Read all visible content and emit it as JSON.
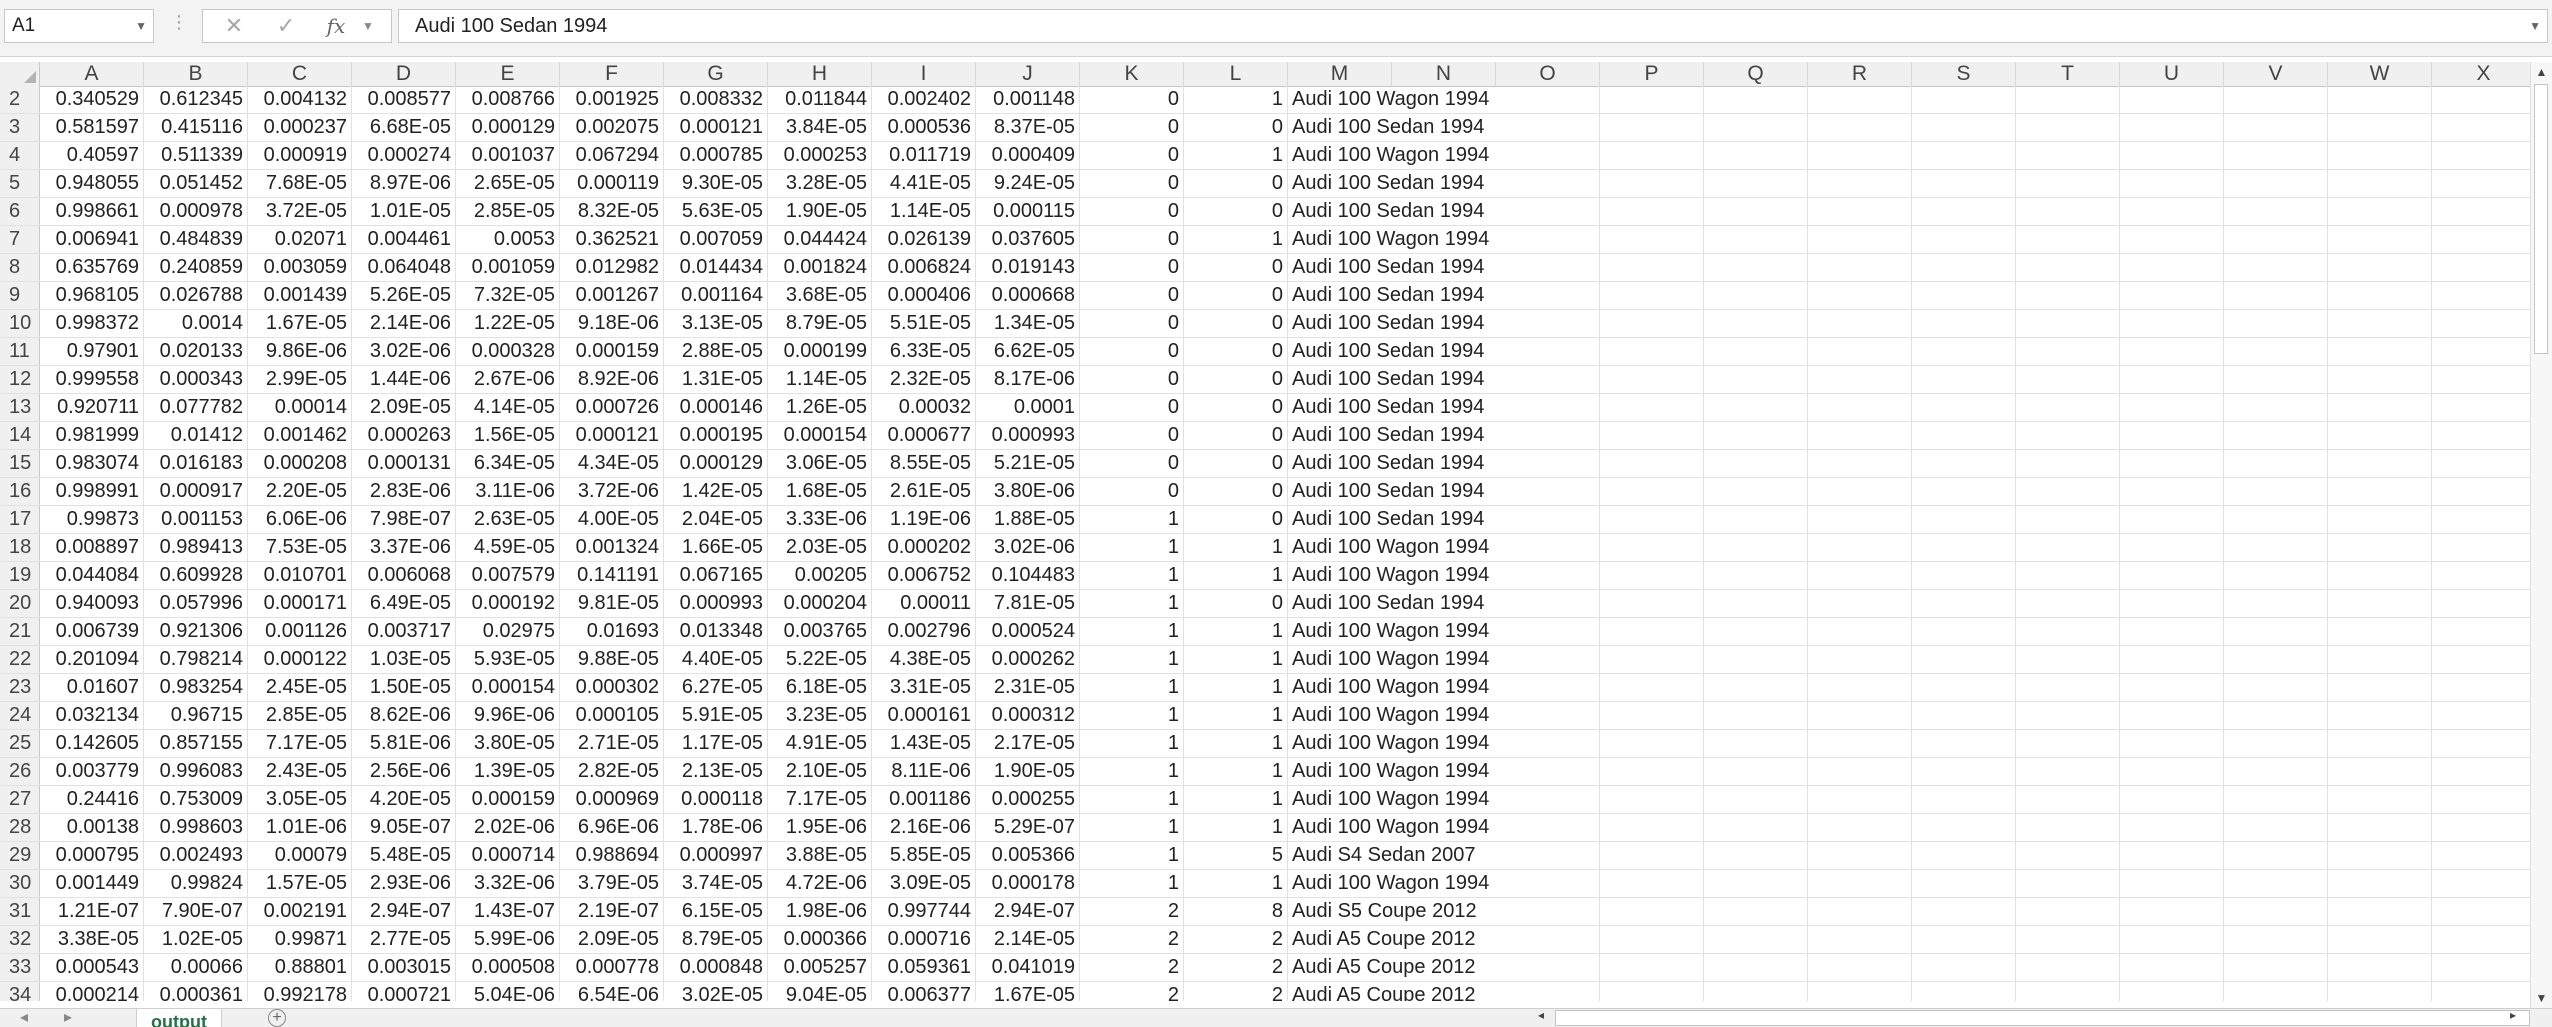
{
  "formula_bar": {
    "name_box": "A1",
    "formula": "Audi 100 Sedan 1994",
    "cancel_icon": "x-icon",
    "enter_icon": "check-icon",
    "function_label": "fx"
  },
  "columns": [
    "A",
    "B",
    "C",
    "D",
    "E",
    "F",
    "G",
    "H",
    "I",
    "J",
    "K",
    "L",
    "M",
    "N",
    "O",
    "P",
    "Q",
    "R",
    "S",
    "T",
    "U",
    "V",
    "W",
    "X"
  ],
  "rows": [
    {
      "n": "2",
      "v": [
        "0.340529",
        "0.612345",
        "0.004132",
        "0.008577",
        "0.008766",
        "0.001925",
        "0.008332",
        "0.011844",
        "0.002402",
        "0.001148",
        "0",
        "1",
        "Audi 100 Wagon 1994"
      ]
    },
    {
      "n": "3",
      "v": [
        "0.581597",
        "0.415116",
        "0.000237",
        "6.68E-05",
        "0.000129",
        "0.002075",
        "0.000121",
        "3.84E-05",
        "0.000536",
        "8.37E-05",
        "0",
        "0",
        "Audi 100 Sedan 1994"
      ]
    },
    {
      "n": "4",
      "v": [
        "0.40597",
        "0.511339",
        "0.000919",
        "0.000274",
        "0.001037",
        "0.067294",
        "0.000785",
        "0.000253",
        "0.011719",
        "0.000409",
        "0",
        "1",
        "Audi 100 Wagon 1994"
      ]
    },
    {
      "n": "5",
      "v": [
        "0.948055",
        "0.051452",
        "7.68E-05",
        "8.97E-06",
        "2.65E-05",
        "0.000119",
        "9.30E-05",
        "3.28E-05",
        "4.41E-05",
        "9.24E-05",
        "0",
        "0",
        "Audi 100 Sedan 1994"
      ]
    },
    {
      "n": "6",
      "v": [
        "0.998661",
        "0.000978",
        "3.72E-05",
        "1.01E-05",
        "2.85E-05",
        "8.32E-05",
        "5.63E-05",
        "1.90E-05",
        "1.14E-05",
        "0.000115",
        "0",
        "0",
        "Audi 100 Sedan 1994"
      ]
    },
    {
      "n": "7",
      "v": [
        "0.006941",
        "0.484839",
        "0.02071",
        "0.004461",
        "0.0053",
        "0.362521",
        "0.007059",
        "0.044424",
        "0.026139",
        "0.037605",
        "0",
        "1",
        "Audi 100 Wagon 1994"
      ]
    },
    {
      "n": "8",
      "v": [
        "0.635769",
        "0.240859",
        "0.003059",
        "0.064048",
        "0.001059",
        "0.012982",
        "0.014434",
        "0.001824",
        "0.006824",
        "0.019143",
        "0",
        "0",
        "Audi 100 Sedan 1994"
      ]
    },
    {
      "n": "9",
      "v": [
        "0.968105",
        "0.026788",
        "0.001439",
        "5.26E-05",
        "7.32E-05",
        "0.001267",
        "0.001164",
        "3.68E-05",
        "0.000406",
        "0.000668",
        "0",
        "0",
        "Audi 100 Sedan 1994"
      ]
    },
    {
      "n": "10",
      "v": [
        "0.998372",
        "0.0014",
        "1.67E-05",
        "2.14E-06",
        "1.22E-05",
        "9.18E-06",
        "3.13E-05",
        "8.79E-05",
        "5.51E-05",
        "1.34E-05",
        "0",
        "0",
        "Audi 100 Sedan 1994"
      ]
    },
    {
      "n": "11",
      "v": [
        "0.97901",
        "0.020133",
        "9.86E-06",
        "3.02E-06",
        "0.000328",
        "0.000159",
        "2.88E-05",
        "0.000199",
        "6.33E-05",
        "6.62E-05",
        "0",
        "0",
        "Audi 100 Sedan 1994"
      ]
    },
    {
      "n": "12",
      "v": [
        "0.999558",
        "0.000343",
        "2.99E-05",
        "1.44E-06",
        "2.67E-06",
        "8.92E-06",
        "1.31E-05",
        "1.14E-05",
        "2.32E-05",
        "8.17E-06",
        "0",
        "0",
        "Audi 100 Sedan 1994"
      ]
    },
    {
      "n": "13",
      "v": [
        "0.920711",
        "0.077782",
        "0.00014",
        "2.09E-05",
        "4.14E-05",
        "0.000726",
        "0.000146",
        "1.26E-05",
        "0.00032",
        "0.0001",
        "0",
        "0",
        "Audi 100 Sedan 1994"
      ]
    },
    {
      "n": "14",
      "v": [
        "0.981999",
        "0.01412",
        "0.001462",
        "0.000263",
        "1.56E-05",
        "0.000121",
        "0.000195",
        "0.000154",
        "0.000677",
        "0.000993",
        "0",
        "0",
        "Audi 100 Sedan 1994"
      ]
    },
    {
      "n": "15",
      "v": [
        "0.983074",
        "0.016183",
        "0.000208",
        "0.000131",
        "6.34E-05",
        "4.34E-05",
        "0.000129",
        "3.06E-05",
        "8.55E-05",
        "5.21E-05",
        "0",
        "0",
        "Audi 100 Sedan 1994"
      ]
    },
    {
      "n": "16",
      "v": [
        "0.998991",
        "0.000917",
        "2.20E-05",
        "2.83E-06",
        "3.11E-06",
        "3.72E-06",
        "1.42E-05",
        "1.68E-05",
        "2.61E-05",
        "3.80E-06",
        "0",
        "0",
        "Audi 100 Sedan 1994"
      ]
    },
    {
      "n": "17",
      "v": [
        "0.99873",
        "0.001153",
        "6.06E-06",
        "7.98E-07",
        "2.63E-05",
        "4.00E-05",
        "2.04E-05",
        "3.33E-06",
        "1.19E-06",
        "1.88E-05",
        "1",
        "0",
        "Audi 100 Sedan 1994"
      ]
    },
    {
      "n": "18",
      "v": [
        "0.008897",
        "0.989413",
        "7.53E-05",
        "3.37E-06",
        "4.59E-05",
        "0.001324",
        "1.66E-05",
        "2.03E-05",
        "0.000202",
        "3.02E-06",
        "1",
        "1",
        "Audi 100 Wagon 1994"
      ]
    },
    {
      "n": "19",
      "v": [
        "0.044084",
        "0.609928",
        "0.010701",
        "0.006068",
        "0.007579",
        "0.141191",
        "0.067165",
        "0.00205",
        "0.006752",
        "0.104483",
        "1",
        "1",
        "Audi 100 Wagon 1994"
      ]
    },
    {
      "n": "20",
      "v": [
        "0.940093",
        "0.057996",
        "0.000171",
        "6.49E-05",
        "0.000192",
        "9.81E-05",
        "0.000993",
        "0.000204",
        "0.00011",
        "7.81E-05",
        "1",
        "0",
        "Audi 100 Sedan 1994"
      ]
    },
    {
      "n": "21",
      "v": [
        "0.006739",
        "0.921306",
        "0.001126",
        "0.003717",
        "0.02975",
        "0.01693",
        "0.013348",
        "0.003765",
        "0.002796",
        "0.000524",
        "1",
        "1",
        "Audi 100 Wagon 1994"
      ]
    },
    {
      "n": "22",
      "v": [
        "0.201094",
        "0.798214",
        "0.000122",
        "1.03E-05",
        "5.93E-05",
        "9.88E-05",
        "4.40E-05",
        "5.22E-05",
        "4.38E-05",
        "0.000262",
        "1",
        "1",
        "Audi 100 Wagon 1994"
      ]
    },
    {
      "n": "23",
      "v": [
        "0.01607",
        "0.983254",
        "2.45E-05",
        "1.50E-05",
        "0.000154",
        "0.000302",
        "6.27E-05",
        "6.18E-05",
        "3.31E-05",
        "2.31E-05",
        "1",
        "1",
        "Audi 100 Wagon 1994"
      ]
    },
    {
      "n": "24",
      "v": [
        "0.032134",
        "0.96715",
        "2.85E-05",
        "8.62E-06",
        "9.96E-06",
        "0.000105",
        "5.91E-05",
        "3.23E-05",
        "0.000161",
        "0.000312",
        "1",
        "1",
        "Audi 100 Wagon 1994"
      ]
    },
    {
      "n": "25",
      "v": [
        "0.142605",
        "0.857155",
        "7.17E-05",
        "5.81E-06",
        "3.80E-05",
        "2.71E-05",
        "1.17E-05",
        "4.91E-05",
        "1.43E-05",
        "2.17E-05",
        "1",
        "1",
        "Audi 100 Wagon 1994"
      ]
    },
    {
      "n": "26",
      "v": [
        "0.003779",
        "0.996083",
        "2.43E-05",
        "2.56E-06",
        "1.39E-05",
        "2.82E-05",
        "2.13E-05",
        "2.10E-05",
        "8.11E-06",
        "1.90E-05",
        "1",
        "1",
        "Audi 100 Wagon 1994"
      ]
    },
    {
      "n": "27",
      "v": [
        "0.24416",
        "0.753009",
        "3.05E-05",
        "4.20E-05",
        "0.000159",
        "0.000969",
        "0.000118",
        "7.17E-05",
        "0.001186",
        "0.000255",
        "1",
        "1",
        "Audi 100 Wagon 1994"
      ]
    },
    {
      "n": "28",
      "v": [
        "0.00138",
        "0.998603",
        "1.01E-06",
        "9.05E-07",
        "2.02E-06",
        "6.96E-06",
        "1.78E-06",
        "1.95E-06",
        "2.16E-06",
        "5.29E-07",
        "1",
        "1",
        "Audi 100 Wagon 1994"
      ]
    },
    {
      "n": "29",
      "v": [
        "0.000795",
        "0.002493",
        "0.00079",
        "5.48E-05",
        "0.000714",
        "0.988694",
        "0.000997",
        "3.88E-05",
        "5.85E-05",
        "0.005366",
        "1",
        "5",
        "Audi S4 Sedan 2007"
      ]
    },
    {
      "n": "30",
      "v": [
        "0.001449",
        "0.99824",
        "1.57E-05",
        "2.93E-06",
        "3.32E-06",
        "3.79E-05",
        "3.74E-05",
        "4.72E-06",
        "3.09E-05",
        "0.000178",
        "1",
        "1",
        "Audi 100 Wagon 1994"
      ]
    },
    {
      "n": "31",
      "v": [
        "1.21E-07",
        "7.90E-07",
        "0.002191",
        "2.94E-07",
        "1.43E-07",
        "2.19E-07",
        "6.15E-05",
        "1.98E-06",
        "0.997744",
        "2.94E-07",
        "2",
        "8",
        "Audi S5 Coupe 2012"
      ]
    },
    {
      "n": "32",
      "v": [
        "3.38E-05",
        "1.02E-05",
        "0.99871",
        "2.77E-05",
        "5.99E-06",
        "2.09E-05",
        "8.79E-05",
        "0.000366",
        "0.000716",
        "2.14E-05",
        "2",
        "2",
        "Audi A5 Coupe 2012"
      ]
    },
    {
      "n": "33",
      "v": [
        "0.000543",
        "0.00066",
        "0.88801",
        "0.003015",
        "0.000508",
        "0.000778",
        "0.000848",
        "0.005257",
        "0.059361",
        "0.041019",
        "2",
        "2",
        "Audi A5 Coupe 2012"
      ]
    },
    {
      "n": "34",
      "v": [
        "0.000214",
        "0.000361",
        "0.992178",
        "0.000721",
        "5.04E-06",
        "6.54E-06",
        "3.02E-05",
        "9.04E-05",
        "0.006377",
        "1.67E-05",
        "2",
        "2",
        "Audi A5 Coupe 2012"
      ]
    }
  ],
  "sheet_tabs": [
    "output"
  ],
  "colors": {
    "accent": "#217346",
    "header_bg": "#f0f0f0",
    "grid_line": "#e1e1e1"
  }
}
